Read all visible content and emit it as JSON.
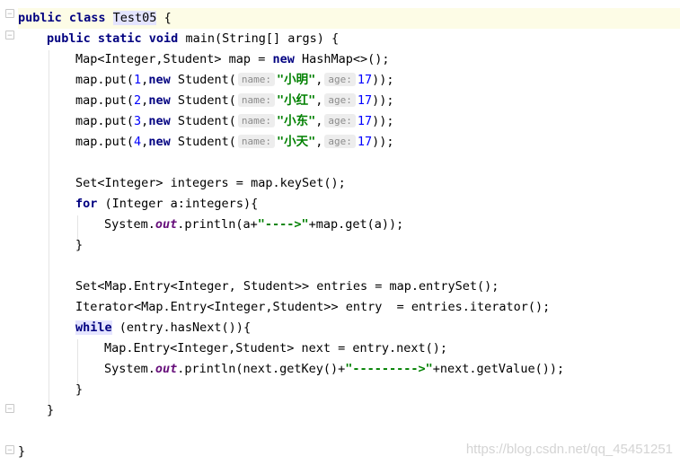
{
  "editor": {
    "lines": [
      {
        "id": "l1",
        "segs": [
          {
            "t": "public class ",
            "c": "kw"
          },
          {
            "t": "Test05",
            "c": "cls-hl"
          },
          {
            "t": " {",
            "c": ""
          }
        ]
      },
      {
        "id": "l2",
        "segs": [
          {
            "t": "public static void ",
            "c": "kw"
          },
          {
            "t": "main(String[] args) {",
            "c": ""
          }
        ]
      },
      {
        "id": "l3",
        "segs": [
          {
            "t": "Map<Integer,Student> map = ",
            "c": ""
          },
          {
            "t": "new ",
            "c": "kw"
          },
          {
            "t": "HashMap<>();",
            "c": ""
          }
        ]
      },
      {
        "id": "l4",
        "segs": [
          {
            "t": "map.put(",
            "c": ""
          },
          {
            "t": "1",
            "c": "num"
          },
          {
            "t": ",",
            "c": ""
          },
          {
            "t": "new ",
            "c": "kw"
          },
          {
            "t": "Student(",
            "c": ""
          },
          {
            "t": "name:",
            "c": "hint"
          },
          {
            "t": "\"小明\"",
            "c": "str"
          },
          {
            "t": ",",
            "c": ""
          },
          {
            "t": "age:",
            "c": "hint"
          },
          {
            "t": "17",
            "c": "num"
          },
          {
            "t": "));",
            "c": ""
          }
        ]
      },
      {
        "id": "l5",
        "segs": [
          {
            "t": "map.put(",
            "c": ""
          },
          {
            "t": "2",
            "c": "num"
          },
          {
            "t": ",",
            "c": ""
          },
          {
            "t": "new ",
            "c": "kw"
          },
          {
            "t": "Student(",
            "c": ""
          },
          {
            "t": "name:",
            "c": "hint"
          },
          {
            "t": "\"小红\"",
            "c": "str"
          },
          {
            "t": ",",
            "c": ""
          },
          {
            "t": "age:",
            "c": "hint"
          },
          {
            "t": "17",
            "c": "num"
          },
          {
            "t": "));",
            "c": ""
          }
        ]
      },
      {
        "id": "l6",
        "segs": [
          {
            "t": "map.put(",
            "c": ""
          },
          {
            "t": "3",
            "c": "num"
          },
          {
            "t": ",",
            "c": ""
          },
          {
            "t": "new ",
            "c": "kw"
          },
          {
            "t": "Student(",
            "c": ""
          },
          {
            "t": "name:",
            "c": "hint"
          },
          {
            "t": "\"小东\"",
            "c": "str"
          },
          {
            "t": ",",
            "c": ""
          },
          {
            "t": "age:",
            "c": "hint"
          },
          {
            "t": "17",
            "c": "num"
          },
          {
            "t": "));",
            "c": ""
          }
        ]
      },
      {
        "id": "l7",
        "segs": [
          {
            "t": "map.put(",
            "c": ""
          },
          {
            "t": "4",
            "c": "num"
          },
          {
            "t": ",",
            "c": ""
          },
          {
            "t": "new ",
            "c": "kw"
          },
          {
            "t": "Student(",
            "c": ""
          },
          {
            "t": "name:",
            "c": "hint"
          },
          {
            "t": "\"小天\"",
            "c": "str"
          },
          {
            "t": ",",
            "c": ""
          },
          {
            "t": "age:",
            "c": "hint"
          },
          {
            "t": "17",
            "c": "num"
          },
          {
            "t": "));",
            "c": ""
          }
        ]
      },
      {
        "id": "l8",
        "segs": []
      },
      {
        "id": "l9",
        "segs": [
          {
            "t": "Set<Integer> integers = map.keySet();",
            "c": ""
          }
        ]
      },
      {
        "id": "l10",
        "segs": [
          {
            "t": "for ",
            "c": "kw"
          },
          {
            "t": "(Integer a:integers){",
            "c": ""
          }
        ]
      },
      {
        "id": "l11",
        "segs": [
          {
            "t": "System.",
            "c": ""
          },
          {
            "t": "out",
            "c": "static-f"
          },
          {
            "t": ".println(a+",
            "c": ""
          },
          {
            "t": "\"---->\"",
            "c": "str"
          },
          {
            "t": "+map.get(a));",
            "c": ""
          }
        ]
      },
      {
        "id": "l12",
        "segs": [
          {
            "t": "}",
            "c": ""
          }
        ]
      },
      {
        "id": "l13",
        "segs": []
      },
      {
        "id": "l14",
        "segs": [
          {
            "t": "Set<Map.Entry<Integer, Student>> entries = map.entrySet();",
            "c": ""
          }
        ]
      },
      {
        "id": "l15",
        "segs": [
          {
            "t": "Iterator<Map.Entry<Integer,Student>> entry  = entries.iterator();",
            "c": ""
          }
        ]
      },
      {
        "id": "l16",
        "segs": [
          {
            "t": "while",
            "c": "kw while-hl"
          },
          {
            "t": " (entry.hasNext()){",
            "c": ""
          }
        ]
      },
      {
        "id": "l17",
        "segs": [
          {
            "t": "Map.Entry<Integer,Student> next = entry.next();",
            "c": ""
          }
        ]
      },
      {
        "id": "l18",
        "segs": [
          {
            "t": "System.",
            "c": ""
          },
          {
            "t": "out",
            "c": "static-f"
          },
          {
            "t": ".println(next.getKey()+",
            "c": ""
          },
          {
            "t": "\"--------->\"",
            "c": "str"
          },
          {
            "t": "+next.getValue());",
            "c": ""
          }
        ]
      },
      {
        "id": "l19",
        "segs": [
          {
            "t": "}",
            "c": ""
          }
        ]
      },
      {
        "id": "l20",
        "segs": [
          {
            "t": "}",
            "c": ""
          }
        ]
      },
      {
        "id": "l21",
        "segs": []
      },
      {
        "id": "l22",
        "segs": [
          {
            "t": "}",
            "c": ""
          }
        ]
      }
    ]
  },
  "watermark": "https://blog.csdn.net/qq_45451251"
}
